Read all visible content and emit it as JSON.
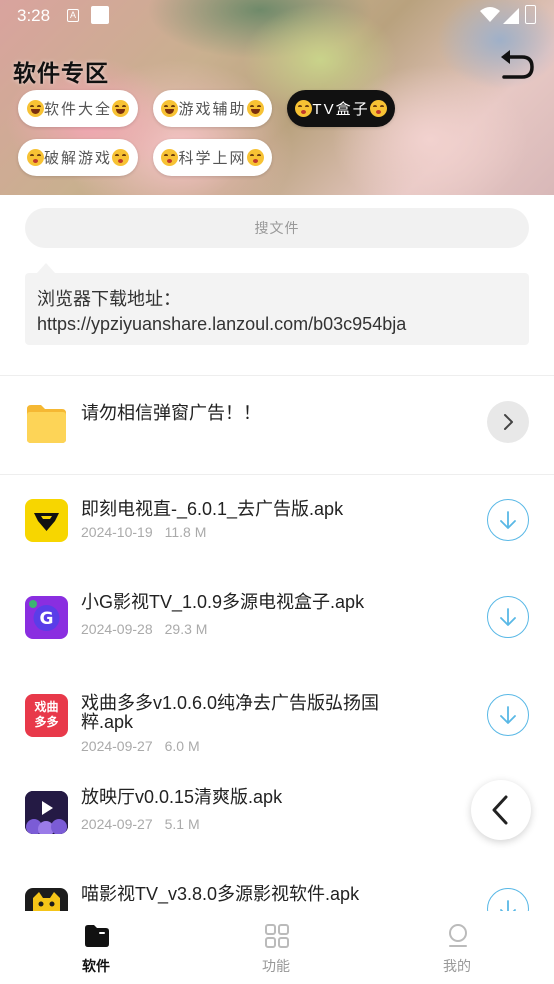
{
  "status_bar": {
    "time": "3:28",
    "a_badge": "A"
  },
  "header": {
    "title": "软件专区",
    "back_icon": "undo-arrow-icon"
  },
  "chips": [
    {
      "label": "软件大全",
      "emoji": "grin",
      "active": false
    },
    {
      "label": "游戏辅助",
      "emoji": "grin",
      "active": false
    },
    {
      "label": "TV盒子",
      "emoji": "kiss",
      "active": true
    },
    {
      "label": "破解游戏",
      "emoji": "kiss",
      "active": false
    },
    {
      "label": "科学上网",
      "emoji": "kiss",
      "active": false
    }
  ],
  "search": {
    "placeholder": "搜文件"
  },
  "notice": {
    "line1": "浏览器下载地址：",
    "line2": "https://ypziyuanshare.lanzoul.com/b03c954bja"
  },
  "folder": {
    "name": "请勿相信弹窗广告！！"
  },
  "files": [
    {
      "name": "即刻电视直-_6.0.1_去广告版.apk",
      "date": "2024-10-19",
      "size": "11.8 M",
      "icon": "jike-tv-icon",
      "downloadable": true
    },
    {
      "name": "小G影视TV_1.0.9多源电视盒子.apk",
      "date": "2024-09-28",
      "size": "29.3 M",
      "icon": "xiaog-tv-icon",
      "downloadable": true
    },
    {
      "name": "戏曲多多v1.0.6.0纯净去广告版弘扬国粹.apk",
      "date": "2024-09-27",
      "size": "6.0 M",
      "icon": "xiqu-duoduo-icon",
      "downloadable": true,
      "icon_text_1": "戏曲",
      "icon_text_2": "多多"
    },
    {
      "name": "放映厅v0.0.15清爽版.apk",
      "date": "2024-09-27",
      "size": "5.1 M",
      "icon": "fangyingting-icon",
      "downloadable": false
    },
    {
      "name": "喵影视TV_v3.8.0多源影视软件.apk",
      "date": "",
      "size": "",
      "icon": "miao-tv-icon",
      "downloadable": true
    }
  ],
  "nav": [
    {
      "label": "软件",
      "icon": "folder-icon",
      "active": true
    },
    {
      "label": "功能",
      "icon": "grid-icon",
      "active": false
    },
    {
      "label": "我的",
      "icon": "profile-icon",
      "active": false
    }
  ],
  "colors": {
    "accent": "#59b8e6",
    "folder": "#fdd457",
    "active_chip": "#111111"
  }
}
